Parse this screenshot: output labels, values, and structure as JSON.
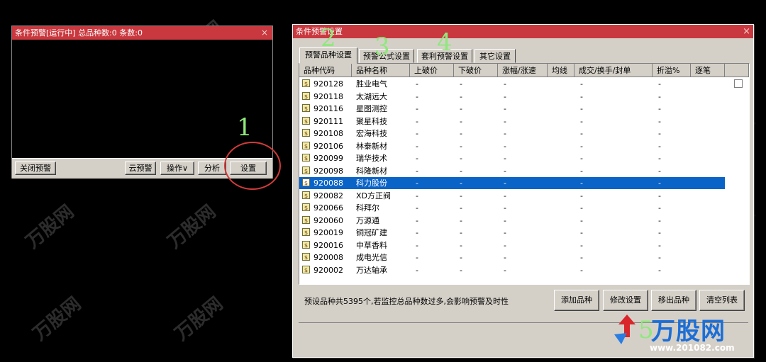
{
  "alert_window": {
    "title": "条件预警[运行中] 总品种数:0 条数:0",
    "close": "×",
    "buttons": {
      "close_alert": "关闭预警",
      "cloud_alert": "云预警",
      "operation": "操作∨",
      "analysis": "分析",
      "settings": "设置"
    }
  },
  "settings_dialog": {
    "title": "条件预警设置",
    "close": "×",
    "tabs": [
      "预警品种设置",
      "预警公式设置",
      "套利预警设置",
      "其它设置"
    ],
    "columns": [
      "品种代码",
      "品种名称",
      "上破价",
      "下破价",
      "涨幅/涨速",
      "均线",
      "成交/换手/封单",
      "折溢%",
      "逐笔"
    ],
    "rows": [
      {
        "code": "920128",
        "name": "胜业电气"
      },
      {
        "code": "920118",
        "name": "太湖远大"
      },
      {
        "code": "920116",
        "name": "星图测控"
      },
      {
        "code": "920111",
        "name": "聚星科技"
      },
      {
        "code": "920108",
        "name": "宏海科技"
      },
      {
        "code": "920106",
        "name": "林泰新材"
      },
      {
        "code": "920099",
        "name": "瑞华技术"
      },
      {
        "code": "920098",
        "name": "科隆新材"
      },
      {
        "code": "920088",
        "name": "科力股份"
      },
      {
        "code": "920082",
        "name": "XD方正阀"
      },
      {
        "code": "920066",
        "name": "科拜尔"
      },
      {
        "code": "920060",
        "name": "万源通"
      },
      {
        "code": "920019",
        "name": "铜冠矿建"
      },
      {
        "code": "920016",
        "name": "中草香料"
      },
      {
        "code": "920008",
        "name": "成电光信"
      },
      {
        "code": "920002",
        "name": "万达轴承"
      }
    ],
    "dash": "-",
    "status_text": "预设品种共5395个,若监控总品种数过多,会影响预警及时性",
    "buttons": {
      "add": "添加品种",
      "modify": "修改设置",
      "remove": "移出品种",
      "clear": "清空列表"
    }
  },
  "watermark": {
    "brand": "万股网",
    "url": "www.201082.com"
  },
  "annotations": [
    "1",
    "2",
    "3",
    "4",
    "5"
  ]
}
